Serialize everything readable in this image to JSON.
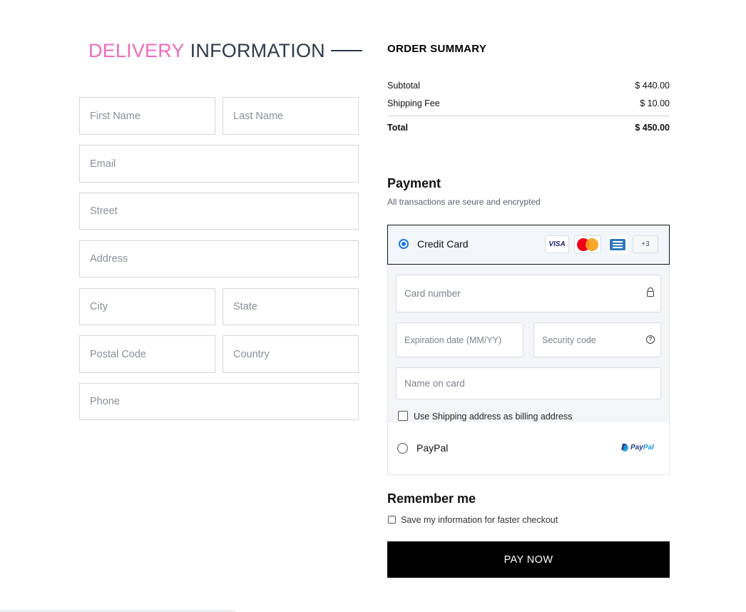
{
  "delivery": {
    "title_accent": "DELIVERY",
    "title_rest": "INFORMATION",
    "fields": {
      "first_name": "First Name",
      "last_name": "Last Name",
      "email": "Email",
      "street": "Street",
      "address": "Address",
      "city": "City",
      "state": "State",
      "postal_code": "Postal Code",
      "country": "Country",
      "phone": "Phone"
    }
  },
  "summary": {
    "title": "ORDER SUMMARY",
    "subtotal_label": "Subtotal",
    "subtotal_value": "$ 440.00",
    "shipping_label": "Shipping Fee",
    "shipping_value": "$ 10.00",
    "total_label": "Total",
    "total_value": "$ 450.00"
  },
  "payment": {
    "title": "Payment",
    "subtitle": "All transactions are seure and encrypted",
    "credit_card": {
      "label": "Credit Card",
      "selected": true,
      "logos": {
        "visa": "VISA",
        "more": "+3"
      },
      "card_number_placeholder": "Card number",
      "expiration_placeholder": "Expiration date (MM/YY)",
      "security_placeholder": "Security code",
      "name_placeholder": "Name on card",
      "billing_checkbox_label": "Use Shipping address as billing address",
      "billing_checked": false
    },
    "paypal": {
      "label": "PayPal",
      "logo_text_1": "Pay",
      "logo_text_2": "Pal",
      "selected": false
    }
  },
  "remember": {
    "title": "Remember me",
    "checkbox_label": "Save my information for faster checkout",
    "checked": false
  },
  "pay_button": "PAY NOW",
  "colors": {
    "accent": "#f06bbd",
    "heading": "#2f3b4c",
    "button_bg": "#000000",
    "radio_selected": "#1a73e8"
  }
}
